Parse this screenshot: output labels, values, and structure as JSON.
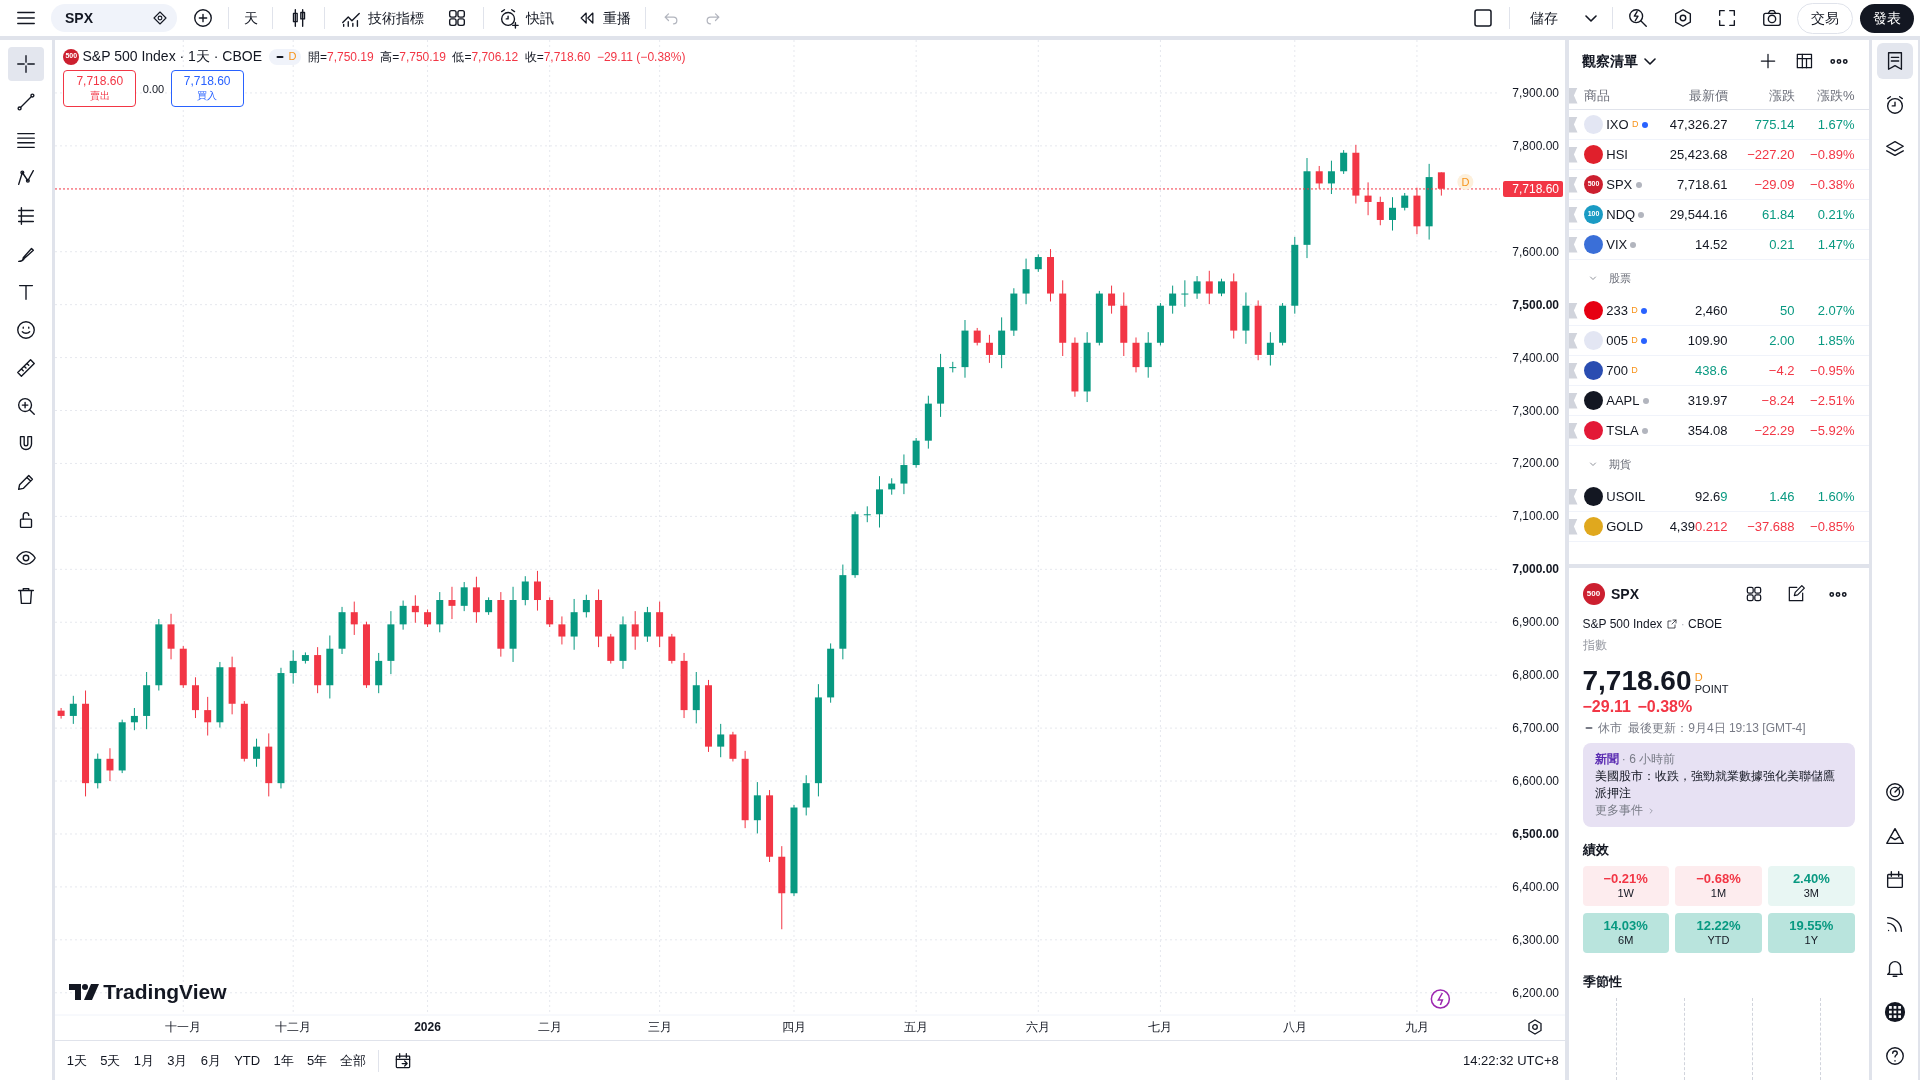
{
  "toolbar": {
    "symbol": "SPX",
    "interval": "天",
    "indicators": "技術指標",
    "alerts": "快訊",
    "replay": "重播",
    "save": "儲存",
    "trade": "交易",
    "publish": "發表"
  },
  "left_tools": [
    {
      "kind": "crosshair",
      "selected": true
    },
    {
      "kind": "trendline",
      "selected": false
    },
    {
      "kind": "lines",
      "selected": false
    },
    {
      "kind": "pattern",
      "selected": false
    },
    {
      "kind": "fib",
      "selected": false
    },
    {
      "kind": "brush",
      "selected": false
    },
    {
      "kind": "text",
      "selected": false
    },
    {
      "kind": "emoji",
      "selected": false
    },
    {
      "kind": "ruler",
      "selected": false
    },
    {
      "kind": "zoom",
      "selected": false
    },
    {
      "kind": "magnet",
      "selected": false
    },
    {
      "kind": "pencil",
      "selected": false
    },
    {
      "kind": "lock",
      "selected": false
    },
    {
      "kind": "eye",
      "selected": false
    },
    {
      "kind": "trash",
      "selected": false
    }
  ],
  "legend": {
    "logo_text": "500",
    "title": "S&P 500 Index · 1天 · CBOE",
    "badge": "D",
    "ohlc": [
      {
        "label": "開=",
        "value": "7,750.19"
      },
      {
        "label": "高=",
        "value": "7,750.19"
      },
      {
        "label": "低=",
        "value": "7,706.12"
      },
      {
        "label": "收=",
        "value": "7,718.60"
      }
    ],
    "change": "−29.11 (−0.38%)",
    "negative": true,
    "sell": {
      "price": "7,718.60",
      "label": "賣出"
    },
    "spread": "0.00",
    "buy": {
      "price": "7,718.60",
      "label": "買入"
    }
  },
  "chart": {
    "badge": "D",
    "brand": "TradingView",
    "chart_data": {
      "type": "candlestick",
      "grid": true,
      "ylim": [
        6158,
        8000
      ],
      "yticks": [
        {
          "value": 6200,
          "label": "6,200.00"
        },
        {
          "value": 6300,
          "label": "6,300.00"
        },
        {
          "value": 6400,
          "label": "6,400.00"
        },
        {
          "value": 6500,
          "label": "6,500.00"
        },
        {
          "value": 6600,
          "label": "6,600.00"
        },
        {
          "value": 6700,
          "label": "6,700.00"
        },
        {
          "value": 6800,
          "label": "6,800.00"
        },
        {
          "value": 6900,
          "label": "6,900.00"
        },
        {
          "value": 7000,
          "label": "7,000.00"
        },
        {
          "value": 7100,
          "label": "7,100.00"
        },
        {
          "value": 7200,
          "label": "7,200.00"
        },
        {
          "value": 7300,
          "label": "7,300.00"
        },
        {
          "value": 7400,
          "label": "7,400.00"
        },
        {
          "value": 7500,
          "label": "7,500.00"
        },
        {
          "value": 7600,
          "label": "7,600.00"
        },
        {
          "value": 7800,
          "label": "7,800.00"
        },
        {
          "value": 7900,
          "label": "7,900.00"
        }
      ],
      "ref_lines": [
        {
          "axis": "y",
          "value": 7718.6,
          "label": "7,718.60",
          "color": "#f23645"
        }
      ],
      "categories": [
        null,
        null,
        null,
        null,
        null,
        null,
        null,
        null,
        null,
        null,
        "十一月",
        null,
        null,
        null,
        null,
        null,
        null,
        null,
        null,
        "十二月",
        null,
        null,
        null,
        null,
        null,
        null,
        null,
        null,
        null,
        null,
        "2026",
        null,
        null,
        null,
        null,
        null,
        null,
        null,
        null,
        null,
        "二月",
        null,
        null,
        null,
        null,
        null,
        null,
        null,
        null,
        "三月",
        null,
        null,
        null,
        null,
        null,
        null,
        null,
        null,
        null,
        null,
        "四月",
        null,
        null,
        null,
        null,
        null,
        null,
        null,
        null,
        null,
        "五月",
        null,
        null,
        null,
        null,
        null,
        null,
        null,
        null,
        null,
        "六月",
        null,
        null,
        null,
        null,
        null,
        null,
        null,
        null,
        null,
        "七月",
        null,
        null,
        null,
        null,
        null,
        null,
        null,
        null,
        null,
        null,
        "八月",
        null,
        null,
        null,
        null,
        null,
        null,
        null,
        null,
        null,
        "九月",
        null,
        null
      ],
      "ohlc": [
        [
          6733,
          6738,
          6718,
          6723
        ],
        [
          6723,
          6761,
          6708,
          6746
        ],
        [
          6746,
          6771,
          6571,
          6596
        ],
        [
          6596,
          6652,
          6586,
          6642
        ],
        [
          6642,
          6662,
          6600,
          6620
        ],
        [
          6620,
          6716,
          6615,
          6711
        ],
        [
          6711,
          6738,
          6696,
          6723
        ],
        [
          6723,
          6806,
          6698,
          6781
        ],
        [
          6781,
          6906,
          6771,
          6896
        ],
        [
          6896,
          6916,
          6830,
          6850
        ],
        [
          6850,
          6855,
          6776,
          6781
        ],
        [
          6781,
          6796,
          6719,
          6734
        ],
        [
          6734,
          6759,
          6686,
          6711
        ],
        [
          6711,
          6825,
          6701,
          6815
        ],
        [
          6815,
          6835,
          6726,
          6746
        ],
        [
          6746,
          6751,
          6637,
          6642
        ],
        [
          6642,
          6680,
          6627,
          6665
        ],
        [
          6665,
          6690,
          6571,
          6596
        ],
        [
          6596,
          6814,
          6586,
          6804
        ],
        [
          6804,
          6847,
          6784,
          6827
        ],
        [
          6827,
          6843,
          6822,
          6838
        ],
        [
          6838,
          6853,
          6766,
          6781
        ],
        [
          6781,
          6875,
          6756,
          6850
        ],
        [
          6850,
          6929,
          6840,
          6919
        ],
        [
          6919,
          6939,
          6876,
          6896
        ],
        [
          6896,
          6901,
          6776,
          6781
        ],
        [
          6781,
          6842,
          6766,
          6827
        ],
        [
          6827,
          6921,
          6802,
          6896
        ],
        [
          6896,
          6941,
          6886,
          6931
        ],
        [
          6931,
          6951,
          6899,
          6919
        ],
        [
          6919,
          6924,
          6891,
          6896
        ],
        [
          6896,
          6957,
          6881,
          6942
        ],
        [
          6942,
          6967,
          6906,
          6931
        ],
        [
          6931,
          6976,
          6921,
          6966
        ],
        [
          6966,
          6986,
          6899,
          6919
        ],
        [
          6919,
          6947,
          6914,
          6942
        ],
        [
          6942,
          6957,
          6835,
          6850
        ],
        [
          6850,
          6967,
          6825,
          6942
        ],
        [
          6942,
          6987,
          6932,
          6977
        ],
        [
          6977,
          6997,
          6922,
          6942
        ],
        [
          6942,
          6947,
          6891,
          6896
        ],
        [
          6896,
          6911,
          6858,
          6873
        ],
        [
          6873,
          6944,
          6848,
          6919
        ],
        [
          6919,
          6952,
          6909,
          6942
        ],
        [
          6942,
          6962,
          6853,
          6873
        ],
        [
          6873,
          6878,
          6822,
          6827
        ],
        [
          6827,
          6911,
          6812,
          6896
        ],
        [
          6896,
          6921,
          6848,
          6873
        ],
        [
          6873,
          6929,
          6863,
          6919
        ],
        [
          6919,
          6939,
          6853,
          6873
        ],
        [
          6873,
          6878,
          6822,
          6827
        ],
        [
          6827,
          6842,
          6719,
          6734
        ],
        [
          6734,
          6806,
          6709,
          6781
        ],
        [
          6781,
          6791,
          6655,
          6665
        ],
        [
          6665,
          6708,
          6645,
          6688
        ],
        [
          6688,
          6693,
          6637,
          6642
        ],
        [
          6642,
          6657,
          6511,
          6526
        ],
        [
          6526,
          6598,
          6501,
          6573
        ],
        [
          6573,
          6583,
          6447,
          6457
        ],
        [
          6457,
          6477,
          6320,
          6388
        ],
        [
          6388,
          6555,
          6383,
          6550
        ],
        [
          6550,
          6611,
          6535,
          6596
        ],
        [
          6596,
          6783,
          6571,
          6758
        ],
        [
          6758,
          6860,
          6748,
          6850
        ],
        [
          6850,
          7009,
          6830,
          6989
        ],
        [
          6989,
          7109,
          6984,
          7104
        ],
        [
          7104,
          7119,
          7089,
          7104
        ],
        [
          7104,
          7176,
          7079,
          7151
        ],
        [
          7151,
          7172,
          7141,
          7162
        ],
        [
          7162,
          7217,
          7142,
          7197
        ],
        [
          7197,
          7248,
          7192,
          7243
        ],
        [
          7243,
          7328,
          7228,
          7313
        ],
        [
          7313,
          7407,
          7288,
          7382
        ],
        [
          7382,
          7392,
          7372,
          7382
        ],
        [
          7382,
          7471,
          7362,
          7451
        ],
        [
          7451,
          7456,
          7423,
          7428
        ],
        [
          7428,
          7443,
          7390,
          7405
        ],
        [
          7405,
          7476,
          7380,
          7451
        ],
        [
          7451,
          7531,
          7441,
          7521
        ],
        [
          7521,
          7587,
          7501,
          7567
        ],
        [
          7567,
          7595,
          7562,
          7590
        ],
        [
          7590,
          7605,
          7506,
          7521
        ],
        [
          7521,
          7546,
          7403,
          7428
        ],
        [
          7428,
          7438,
          7326,
          7336
        ],
        [
          7336,
          7448,
          7316,
          7428
        ],
        [
          7428,
          7526,
          7423,
          7521
        ],
        [
          7521,
          7536,
          7483,
          7498
        ],
        [
          7498,
          7523,
          7403,
          7428
        ],
        [
          7428,
          7438,
          7372,
          7382
        ],
        [
          7382,
          7448,
          7362,
          7428
        ],
        [
          7428,
          7503,
          7423,
          7498
        ],
        [
          7498,
          7536,
          7483,
          7521
        ],
        [
          7521,
          7546,
          7496,
          7521
        ],
        [
          7521,
          7554,
          7511,
          7544
        ],
        [
          7544,
          7564,
          7501,
          7521
        ],
        [
          7521,
          7549,
          7516,
          7544
        ],
        [
          7544,
          7559,
          7436,
          7451
        ],
        [
          7451,
          7523,
          7426,
          7498
        ],
        [
          7498,
          7508,
          7395,
          7405
        ],
        [
          7405,
          7448,
          7385,
          7428
        ],
        [
          7428,
          7503,
          7423,
          7498
        ],
        [
          7498,
          7628,
          7483,
          7613
        ],
        [
          7613,
          7777,
          7588,
          7752
        ],
        [
          7752,
          7762,
          7719,
          7729
        ],
        [
          7729,
          7772,
          7709,
          7752
        ],
        [
          7752,
          7792,
          7747,
          7787
        ],
        [
          7787,
          7802,
          7691,
          7706
        ],
        [
          7706,
          7731,
          7669,
          7694
        ],
        [
          7694,
          7704,
          7650,
          7660
        ],
        [
          7660,
          7703,
          7640,
          7683
        ],
        [
          7683,
          7711,
          7678,
          7706
        ],
        [
          7706,
          7721,
          7633,
          7648
        ],
        [
          7648,
          7766,
          7623,
          7741
        ],
        [
          7750,
          7750,
          7706,
          7719
        ]
      ]
    }
  },
  "bottom_bar": {
    "ranges": [
      "1天",
      "5天",
      "1月",
      "3月",
      "6月",
      "YTD",
      "1年",
      "5年",
      "全部"
    ],
    "clock": "14:22:32 UTC+8"
  },
  "watchlist": {
    "title": "觀察清單",
    "columns": [
      "商品",
      "最新價",
      "漲跌",
      "漲跌%"
    ],
    "groups": [
      {
        "items": [
          {
            "symbol": "IXO",
            "badge": "D",
            "live": true,
            "color": "#e3e6f3",
            "last": [
              {
                "text": "47,326.27"
              }
            ],
            "change": "775.14",
            "pct": "1.67%",
            "negative": false
          },
          {
            "symbol": "HSI",
            "color": "#e0202c",
            "last": [
              {
                "text": "25,423.68"
              }
            ],
            "change": "−227.20",
            "pct": "−0.89%",
            "negative": true
          },
          {
            "symbol": "SPX",
            "live": false,
            "color": "#cc1f2f",
            "logo_text": "500",
            "last": [
              {
                "text": "7,718.61"
              }
            ],
            "change": "−29.09",
            "pct": "−0.38%",
            "negative": true
          },
          {
            "symbol": "NDQ",
            "live": false,
            "color": "#1a9bc4",
            "logo_text": "100",
            "last": [
              {
                "text": "29,544.16"
              }
            ],
            "change": "61.84",
            "pct": "0.21%",
            "negative": false
          },
          {
            "symbol": "VIX",
            "live": false,
            "color": "#3a6fd8",
            "last": [
              {
                "text": "14.52"
              }
            ],
            "change": "0.21",
            "pct": "1.47%",
            "negative": false
          }
        ]
      },
      {
        "title": "股票",
        "expanded": true,
        "items": [
          {
            "symbol": "233",
            "badge": "D",
            "live": true,
            "color": "#e60012",
            "last": [
              {
                "text": "2,460"
              }
            ],
            "change": "50",
            "pct": "2.07%",
            "negative": false
          },
          {
            "symbol": "005",
            "badge": "D",
            "live": true,
            "color": "#e3e6f3",
            "last": [
              {
                "text": "109.90"
              }
            ],
            "change": "2.00",
            "pct": "1.85%",
            "negative": false
          },
          {
            "symbol": "700",
            "badge": "D",
            "color": "#2a4db1",
            "last": [
              {
                "text": "438.6",
                "color": "#089981"
              }
            ],
            "change": "−4.2",
            "pct": "−0.95%",
            "negative": true
          },
          {
            "symbol": "AAPL",
            "live": false,
            "color": "#131722",
            "last": [
              {
                "text": "319.97"
              }
            ],
            "change": "−8.24",
            "pct": "−2.51%",
            "negative": true
          },
          {
            "symbol": "TSLA",
            "live": false,
            "color": "#e31937",
            "last": [
              {
                "text": "354.08"
              }
            ],
            "change": "−22.29",
            "pct": "−5.92%",
            "negative": true
          }
        ]
      },
      {
        "title": "期貨",
        "expanded": true,
        "items": [
          {
            "symbol": "USOIL",
            "color": "#131722",
            "last": [
              {
                "text": "92.6"
              },
              {
                "text": "9",
                "color": "#089981"
              }
            ],
            "change": "1.46",
            "pct": "1.60%",
            "negative": false
          },
          {
            "symbol": "GOLD",
            "color": "#e0a81e",
            "last": [
              {
                "text": "4,39"
              },
              {
                "text": "0.212",
                "color": "#f23645"
              }
            ],
            "change": "−37.688",
            "pct": "−0.85%",
            "negative": true
          }
        ]
      }
    ]
  },
  "detail": {
    "logo_text": "500",
    "symbol": "SPX",
    "name": "S&P 500 Index",
    "separator": "·",
    "exchange": "CBOE",
    "type": "指數",
    "price": "7,718.60",
    "badge": "D",
    "unit": "POINT",
    "change": "−29.11",
    "pct": "−0.38%",
    "negative": true,
    "status": "休市",
    "updated": "最後更新：9月4日 19:13 [GMT-4]",
    "news": {
      "meta": "**新聞** · 6 小時前",
      "headline": "美國股市：收跌，強勁就業數據強化美聯儲鷹派押注",
      "more": "更多事件"
    },
    "performance_title": "績效",
    "performance": [
      {
        "value": "−0.21%",
        "period": "1W",
        "negative": true,
        "strong": false
      },
      {
        "value": "−0.68%",
        "period": "1M",
        "negative": true,
        "strong": false
      },
      {
        "value": "2.40%",
        "period": "3M",
        "negative": false,
        "strong": false
      },
      {
        "value": "14.03%",
        "period": "6M",
        "negative": false,
        "strong": true
      },
      {
        "value": "12.22%",
        "period": "YTD",
        "negative": false,
        "strong": true
      },
      {
        "value": "19.55%",
        "period": "1Y",
        "negative": false,
        "strong": true
      }
    ],
    "seasonality_title": "季節性"
  },
  "right_rail": {
    "top": [
      {
        "kind": "watchlist",
        "selected": true
      },
      {
        "kind": "alarm",
        "selected": false
      },
      {
        "kind": "layers",
        "selected": false
      }
    ],
    "bottom": [
      {
        "kind": "target",
        "selected": false
      },
      {
        "kind": "ideas",
        "selected": false
      },
      {
        "kind": "calendar",
        "selected": false
      },
      {
        "kind": "feed",
        "selected": false
      },
      {
        "kind": "bell",
        "selected": false
      },
      {
        "kind": "apps",
        "selected": false
      },
      {
        "kind": "help",
        "selected": false
      }
    ]
  }
}
